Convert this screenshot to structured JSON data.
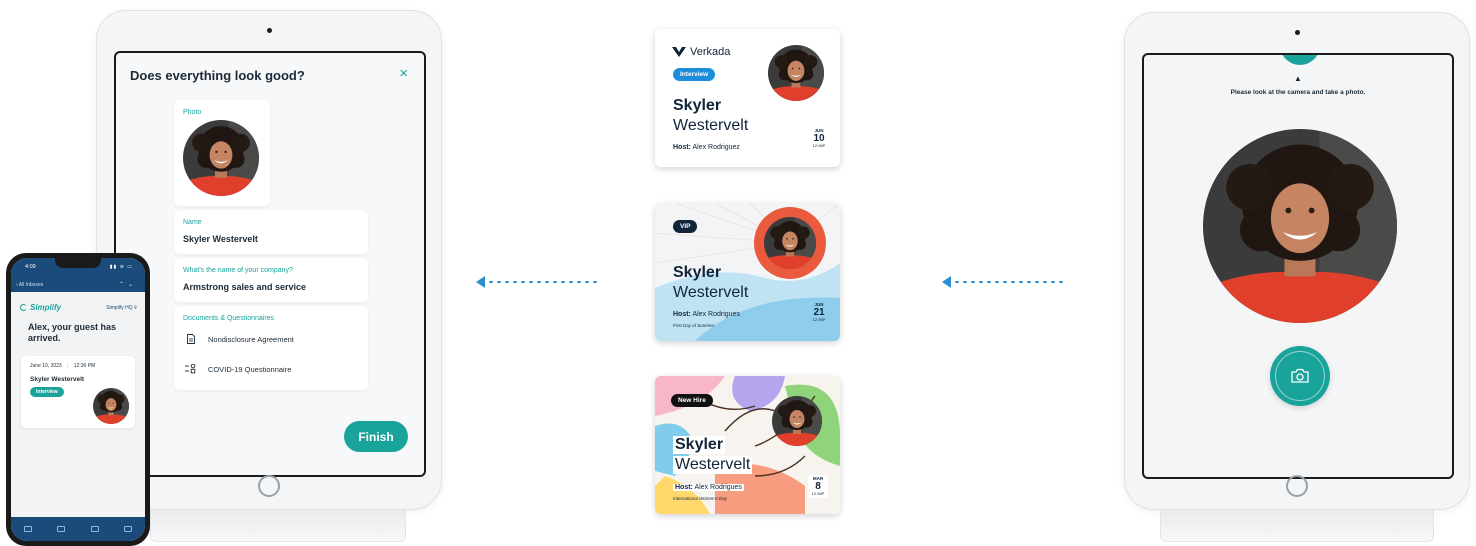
{
  "left_ipad": {
    "dialog_title": "Does everything look good?",
    "close_icon": "×",
    "photo_label": "Photo",
    "name_label": "Name",
    "name_value": "Skyler Westervelt",
    "company_label": "What's the name of your company?",
    "company_value": "Armstrong sales and service",
    "documents_label": "Documents & Questionnaires",
    "documents": [
      {
        "label": "Nondisclosure Agreement",
        "icon": "document-icon"
      },
      {
        "label": "COVID-19 Questionnaire",
        "icon": "checklist-icon"
      }
    ],
    "finish_label": "Finish"
  },
  "phone": {
    "time": "4:09",
    "back_label": "All Inboxes",
    "brand": "Simplify",
    "location": "Simplify HQ",
    "message": "Alex, your guest has arrived.",
    "date": "June 10, 2023",
    "time_slot": "12:36 PM",
    "guest_name": "Skyler Westervelt",
    "tag": "Interview"
  },
  "badges": [
    {
      "logo": "Verkada",
      "tag": "Interview",
      "first": "Skyler",
      "last": "Westervelt",
      "host_prefix": "Host:",
      "host": "Alex Rodriguez",
      "month": "JUN",
      "day": "10",
      "time": "12:36P"
    },
    {
      "tag": "VIP",
      "first": "Skyler",
      "last": "Westervelt",
      "host_prefix": "Host:",
      "host": "Alex Rodrigues",
      "caption": "First Day of Summer",
      "month": "JUN",
      "day": "21",
      "time": "12:36P"
    },
    {
      "tag": "New Hire",
      "first": "Skyler",
      "last": "Westervelt",
      "host_prefix": "Host:",
      "host": "Alex Rodrigues",
      "caption": "International Women's Day",
      "month": "MAR",
      "day": "8",
      "time": "12:36P"
    }
  ],
  "right_ipad": {
    "instruction": "Please look at the camera and take a photo.",
    "pointer": "▲",
    "camera_icon": "camera-icon"
  },
  "colors": {
    "accent": "#1aa39a",
    "arrow": "#2a8ed1",
    "ink": "#11243a",
    "phone_nav": "#1b4b7a"
  }
}
